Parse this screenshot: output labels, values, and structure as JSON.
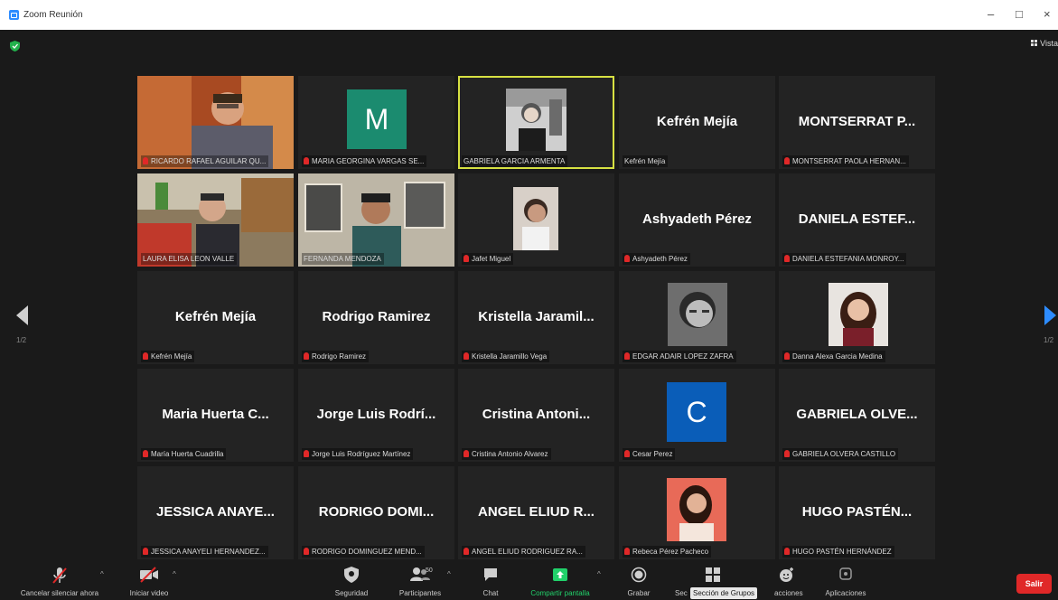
{
  "window": {
    "title": "Zoom Reunión",
    "minimize": "–",
    "maximize": "□",
    "close": "×"
  },
  "meeting": {
    "view_button": "Vista",
    "page_left": "1/2",
    "page_right": "1/2"
  },
  "participants": [
    {
      "label": "RICARDO RAFAEL AGUILAR QU...",
      "type": "video"
    },
    {
      "label": "MARIA GEORGINA VARGAS SE...",
      "type": "initial",
      "initial": "M",
      "color": "#1b8b6f"
    },
    {
      "label": "GABRIELA GARCIA ARMENTA",
      "type": "photo",
      "active": true
    },
    {
      "label": "Kefrén Mejía",
      "type": "name",
      "display": "Kefrén Mejía"
    },
    {
      "label": "MONTSERRAT PAOLA HERNAN...",
      "type": "name",
      "display": "MONTSERRAT P..."
    },
    {
      "label": "LAURA ELISA LEON VALLE",
      "type": "video"
    },
    {
      "label": "FERNANDA MENDOZA",
      "type": "video"
    },
    {
      "label": "Jafet Miguel",
      "type": "photo"
    },
    {
      "label": "Ashyadeth Pérez",
      "type": "name",
      "display": "Ashyadeth Pérez"
    },
    {
      "label": "DANIELA ESTEFANIA MONROY...",
      "type": "name",
      "display": "DANIELA ESTEF..."
    },
    {
      "label": "Kefrén Mejía",
      "type": "name",
      "display": "Kefrén Mejía"
    },
    {
      "label": "Rodrigo Ramirez",
      "type": "name",
      "display": "Rodrigo Ramirez"
    },
    {
      "label": "Kristella Jaramillo Vega",
      "type": "name",
      "display": "Kristella Jaramil..."
    },
    {
      "label": "EDGAR ADAIR LOPEZ ZAFRA",
      "type": "photo"
    },
    {
      "label": "Danna Alexa Garcia Medina",
      "type": "photo"
    },
    {
      "label": "María Huerta Cuadrilla",
      "type": "name",
      "display": "Maria Huerta C..."
    },
    {
      "label": "Jorge Luis Rodríguez Martínez",
      "type": "name",
      "display": "Jorge Luis Rodrí..."
    },
    {
      "label": "Cristina Antonio Alvarez",
      "type": "name",
      "display": "Cristina Antoni..."
    },
    {
      "label": "Cesar Perez",
      "type": "initial",
      "initial": "C",
      "color": "#0a5db8"
    },
    {
      "label": "GABRIELA OLVERA CASTILLO",
      "type": "name",
      "display": "GABRIELA OLVE..."
    },
    {
      "label": "JESSICA ANAYELI HERNANDEZ...",
      "type": "name",
      "display": "JESSICA ANAYE..."
    },
    {
      "label": "RODRIGO DOMINGUEZ MEND...",
      "type": "name",
      "display": "RODRIGO DOMI..."
    },
    {
      "label": "ANGEL ELIUD RODRIGUEZ RA...",
      "type": "name",
      "display": "ANGEL ELIUD R..."
    },
    {
      "label": "Rebeca Pérez Pacheco",
      "type": "photo"
    },
    {
      "label": "HUGO PASTÉN HERNÁNDEZ",
      "type": "name",
      "display": "HUGO PASTÉN..."
    }
  ],
  "toolbar": {
    "unmute": "Cancelar silenciar ahora",
    "start_video": "Iniciar video",
    "security": "Seguridad",
    "participants": "Participantes",
    "participants_count": "50",
    "chat": "Chat",
    "share_screen": "Compartir pantalla",
    "record": "Grabar",
    "breakout_partial": "Sec",
    "breakout_tooltip": "Sección de Grupos",
    "reactions_partial": "acciones",
    "apps": "Aplicaciones",
    "leave": "Salir"
  },
  "colors": {
    "active_speaker": "#d7e142",
    "share_green": "#21d16a",
    "leave_red": "#e02828",
    "muted_red": "#e02828"
  }
}
